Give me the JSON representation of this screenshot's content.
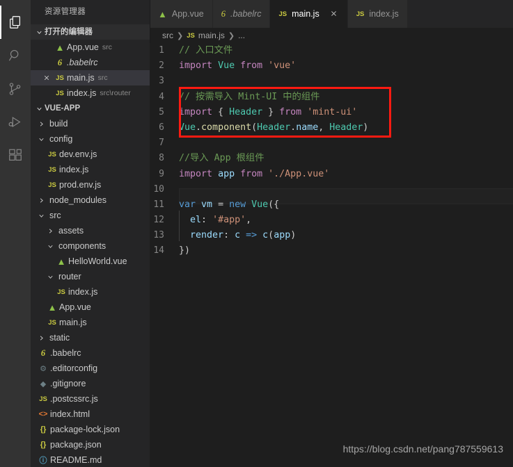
{
  "activitybar": {
    "items": [
      {
        "name": "explorer",
        "icon": "files-icon",
        "active": true
      },
      {
        "name": "search",
        "icon": "search-icon",
        "active": false
      },
      {
        "name": "source-control",
        "icon": "source-control-icon",
        "active": false
      },
      {
        "name": "run-debug",
        "icon": "run-debug-icon",
        "active": false
      },
      {
        "name": "extensions",
        "icon": "extensions-icon",
        "active": false
      }
    ]
  },
  "sidebar": {
    "title": "资源管理器",
    "open_editors": {
      "label": "打开的编辑器",
      "twisty": "chevron-down-icon",
      "items": [
        {
          "name": "App.vue",
          "desc": "src",
          "icon": "vue-icon",
          "selected": false,
          "closable": false,
          "italic": false
        },
        {
          "name": ".babelrc",
          "desc": "",
          "icon": "babel-icon",
          "selected": false,
          "closable": false,
          "italic": true
        },
        {
          "name": "main.js",
          "desc": "src",
          "icon": "js-icon",
          "selected": true,
          "closable": true,
          "italic": false
        },
        {
          "name": "index.js",
          "desc": "src\\router",
          "icon": "js-icon",
          "selected": false,
          "closable": false,
          "italic": false
        }
      ]
    },
    "project": {
      "label": "VUE-APP",
      "twisty": "chevron-down-icon",
      "items": [
        {
          "name": "build",
          "icon": "folder-icon",
          "arrow": "chevron-right-icon",
          "indent": 0,
          "type": "folder"
        },
        {
          "name": "config",
          "icon": "folder-icon",
          "arrow": "chevron-down-icon",
          "indent": 0,
          "type": "folder"
        },
        {
          "name": "dev.env.js",
          "icon": "js-icon",
          "arrow": "",
          "indent": 1,
          "type": "file"
        },
        {
          "name": "index.js",
          "icon": "js-icon",
          "arrow": "",
          "indent": 1,
          "type": "file"
        },
        {
          "name": "prod.env.js",
          "icon": "js-icon",
          "arrow": "",
          "indent": 1,
          "type": "file"
        },
        {
          "name": "node_modules",
          "icon": "folder-icon",
          "arrow": "chevron-right-icon",
          "indent": 0,
          "type": "folder"
        },
        {
          "name": "src",
          "icon": "folder-icon",
          "arrow": "chevron-down-icon",
          "indent": 0,
          "type": "folder"
        },
        {
          "name": "assets",
          "icon": "folder-icon",
          "arrow": "chevron-right-icon",
          "indent": 1,
          "type": "folder"
        },
        {
          "name": "components",
          "icon": "folder-icon",
          "arrow": "chevron-down-icon",
          "indent": 1,
          "type": "folder"
        },
        {
          "name": "HelloWorld.vue",
          "icon": "vue-icon",
          "arrow": "",
          "indent": 2,
          "type": "file"
        },
        {
          "name": "router",
          "icon": "folder-icon",
          "arrow": "chevron-down-icon",
          "indent": 1,
          "type": "folder"
        },
        {
          "name": "index.js",
          "icon": "js-icon",
          "arrow": "",
          "indent": 2,
          "type": "file"
        },
        {
          "name": "App.vue",
          "icon": "vue-icon",
          "arrow": "",
          "indent": 1,
          "type": "file"
        },
        {
          "name": "main.js",
          "icon": "js-icon",
          "arrow": "",
          "indent": 1,
          "type": "file"
        },
        {
          "name": "static",
          "icon": "folder-icon",
          "arrow": "chevron-right-icon",
          "indent": 0,
          "type": "folder"
        },
        {
          "name": ".babelrc",
          "icon": "babel-icon",
          "arrow": "",
          "indent": 0,
          "type": "file"
        },
        {
          "name": ".editorconfig",
          "icon": "gear-icon",
          "arrow": "",
          "indent": 0,
          "type": "file"
        },
        {
          "name": ".gitignore",
          "icon": "git-icon",
          "arrow": "",
          "indent": 0,
          "type": "file"
        },
        {
          "name": ".postcssrc.js",
          "icon": "js-icon",
          "arrow": "",
          "indent": 0,
          "type": "file"
        },
        {
          "name": "index.html",
          "icon": "html-icon",
          "arrow": "",
          "indent": 0,
          "type": "file"
        },
        {
          "name": "package-lock.json",
          "icon": "json-icon",
          "arrow": "",
          "indent": 0,
          "type": "file"
        },
        {
          "name": "package.json",
          "icon": "json-icon",
          "arrow": "",
          "indent": 0,
          "type": "file"
        },
        {
          "name": "README.md",
          "icon": "info-icon",
          "arrow": "",
          "indent": 0,
          "type": "file"
        }
      ]
    }
  },
  "tabs": [
    {
      "label": "App.vue",
      "icon": "vue-icon",
      "active": false,
      "closable": false,
      "italic": false
    },
    {
      "label": ".babelrc",
      "icon": "babel-icon",
      "active": false,
      "closable": false,
      "italic": true
    },
    {
      "label": "main.js",
      "icon": "js-icon",
      "active": true,
      "closable": true,
      "italic": false
    },
    {
      "label": "index.js",
      "icon": "js-icon",
      "active": false,
      "closable": false,
      "italic": false
    }
  ],
  "breadcrumb": {
    "root": "src",
    "file": "main.js",
    "icon": "js-icon",
    "tail": "..."
  },
  "editor": {
    "current_line": 10,
    "lines": [
      {
        "n": 1,
        "text": "// 入口文件"
      },
      {
        "n": 2,
        "text": "import Vue from 'vue'"
      },
      {
        "n": 3,
        "text": ""
      },
      {
        "n": 4,
        "text": "// 按需导入 Mint-UI 中的组件"
      },
      {
        "n": 5,
        "text": "import { Header } from 'mint-ui'"
      },
      {
        "n": 6,
        "text": "Vue.component(Header.name, Header)"
      },
      {
        "n": 7,
        "text": ""
      },
      {
        "n": 8,
        "text": "//导入 App 根组件"
      },
      {
        "n": 9,
        "text": "import app from './App.vue'"
      },
      {
        "n": 10,
        "text": ""
      },
      {
        "n": 11,
        "text": "var vm = new Vue({"
      },
      {
        "n": 12,
        "text": "  el: '#app',"
      },
      {
        "n": 13,
        "text": "  render: c => c(app)"
      },
      {
        "n": 14,
        "text": "})"
      }
    ],
    "annotation": {
      "name": "red-highlight-box",
      "color": "#fe1a11",
      "covers_lines": [
        4,
        5,
        6
      ]
    }
  },
  "watermark": "https://blog.csdn.net/pang787559613",
  "colors": {
    "activitybar_bg": "#333333",
    "sidebar_bg": "#252526",
    "editor_bg": "#1e1e1e",
    "selection_bg": "#37373d",
    "accent_red": "#fe1a11"
  }
}
